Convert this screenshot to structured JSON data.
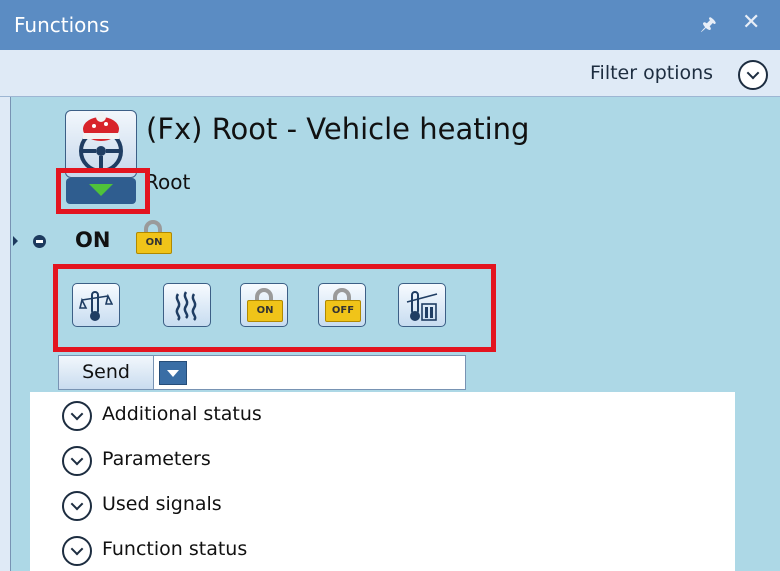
{
  "panel": {
    "title": "Functions",
    "pin_icon": "pin-icon",
    "close_icon": "close-icon",
    "filter_label": "Filter options"
  },
  "function": {
    "title": "(Fx) Root - Vehicle heating",
    "subtitle": "Root",
    "icon": "vehicle-heating-icon",
    "state": "ON",
    "state_lock_label": "ON"
  },
  "commands": {
    "buttons": [
      {
        "name": "thermostat-scale-icon"
      },
      {
        "name": "heat-waves-icon"
      },
      {
        "name": "lock-on-icon",
        "label": "ON"
      },
      {
        "name": "lock-off-icon",
        "label": "OFF"
      },
      {
        "name": "thermometer-bars-icon"
      }
    ],
    "send_label": "Send"
  },
  "sections": [
    {
      "label": "Additional status"
    },
    {
      "label": "Parameters"
    },
    {
      "label": "Used signals"
    },
    {
      "label": "Function status"
    }
  ],
  "colors": {
    "titlebar": "#5b8cc3",
    "content_bg": "#add8e6",
    "highlight": "#e3141f"
  }
}
